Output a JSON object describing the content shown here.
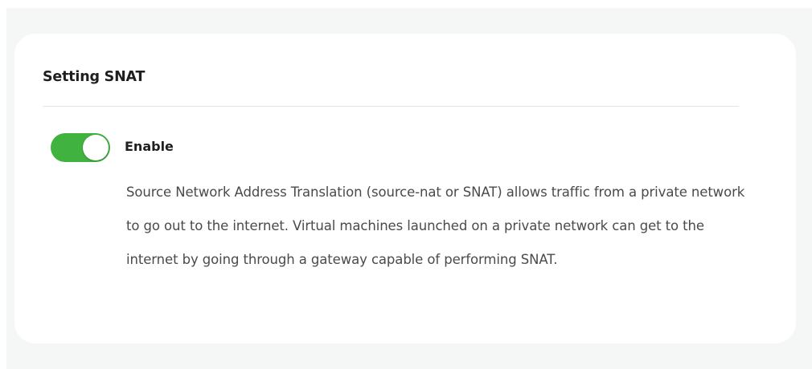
{
  "section": {
    "title": "Setting SNAT"
  },
  "snat_toggle": {
    "label": "Enable",
    "enabled": true,
    "on_color": "#3fb23f"
  },
  "description": "Source Network Address Translation (source-nat or SNAT) allows traffic from a private network to go out to the internet. Virtual machines launched on a private network can get to the internet by going through a gateway capable of performing SNAT."
}
